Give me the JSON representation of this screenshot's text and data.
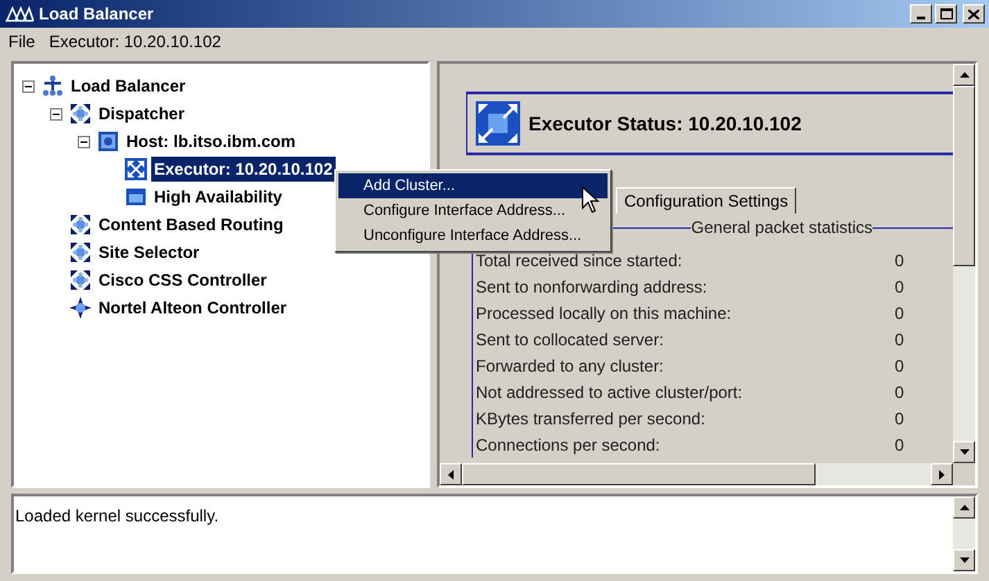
{
  "window": {
    "title": "Load Balancer"
  },
  "menu_bar": [
    {
      "label": "File"
    },
    {
      "label": "Executor: 10.20.10.102"
    }
  ],
  "tree": [
    {
      "label": "Load Balancer",
      "kind": "root",
      "expanded": true,
      "selected": false,
      "children": [
        {
          "label": "Dispatcher",
          "kind": "arrows",
          "expanded": true,
          "selected": false,
          "children": [
            {
              "label": "Host: lb.itso.ibm.com",
              "kind": "host",
              "expanded": true,
              "selected": false,
              "children": [
                {
                  "label": "Executor: 10.20.10.102",
                  "kind": "executor",
                  "selected": true
                },
                {
                  "label": "High Availability",
                  "kind": "tray",
                  "selected": false
                }
              ]
            }
          ]
        },
        {
          "label": "Content Based Routing",
          "kind": "arrows",
          "selected": false
        },
        {
          "label": "Site Selector",
          "kind": "arrows",
          "selected": false
        },
        {
          "label": "Cisco CSS Controller",
          "kind": "arrows",
          "selected": false
        },
        {
          "label": "Nortel Alteon Controller",
          "kind": "star",
          "selected": false
        }
      ]
    }
  ],
  "context_menu": [
    {
      "label": "Add Cluster...",
      "selected": true
    },
    {
      "label": "Configure Interface Address...",
      "selected": false
    },
    {
      "label": "Unconfigure Interface Address...",
      "selected": false
    }
  ],
  "status_panel": {
    "title": "Executor Status: 10.20.10.102",
    "tabs": [
      {
        "label": "Configuration Settings",
        "selected": false
      }
    ],
    "group_title": "General packet statistics",
    "rows": [
      {
        "label": "Total received since started:",
        "value": "0"
      },
      {
        "label": "Sent to nonforwarding address:",
        "value": "0"
      },
      {
        "label": "Processed locally on this machine:",
        "value": "0"
      },
      {
        "label": "Sent to collocated server:",
        "value": "0"
      },
      {
        "label": "Forwarded to any cluster:",
        "value": "0"
      },
      {
        "label": "Not addressed to active cluster/port:",
        "value": "0"
      },
      {
        "label": "KBytes transferred per second:",
        "value": "0"
      },
      {
        "label": "Connections per second:",
        "value": "0"
      }
    ]
  },
  "log": {
    "text": "Loaded kernel successfully."
  }
}
